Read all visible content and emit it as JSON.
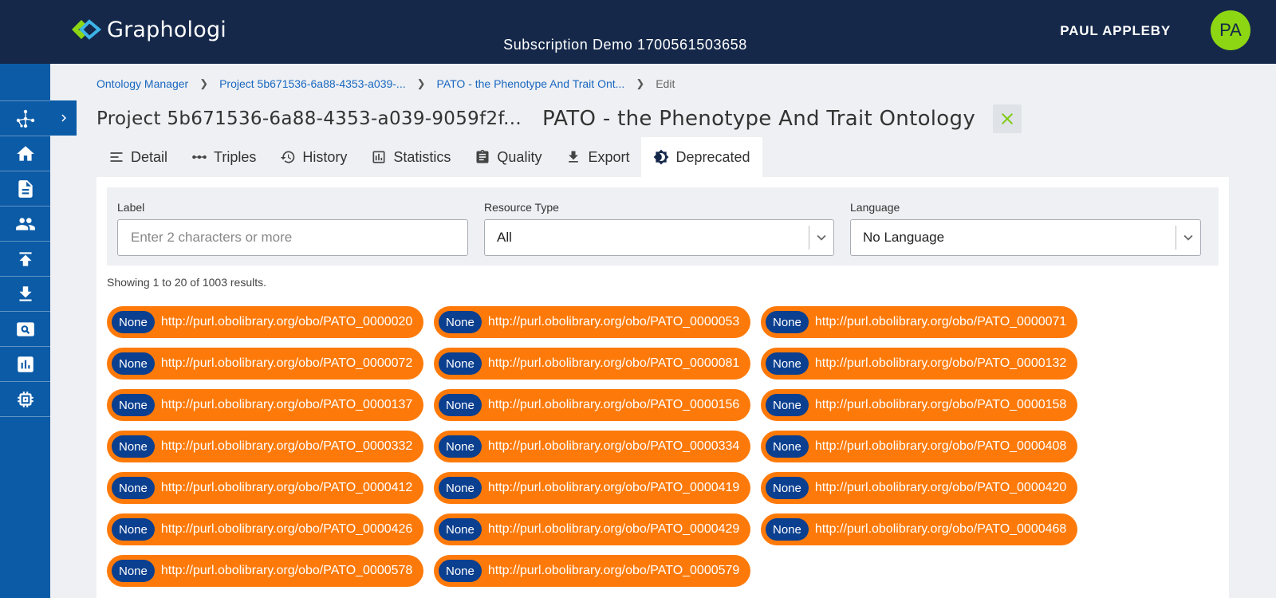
{
  "app": {
    "name": "Graphologi",
    "subscription": "Subscription Demo 1700561503658"
  },
  "user": {
    "name": "PAUL APPLEBY",
    "initials": "PA"
  },
  "sidebar": {
    "items": [
      {
        "icon": "graph-nodes-icon"
      },
      {
        "icon": "home-icon"
      },
      {
        "icon": "document-icon"
      },
      {
        "icon": "people-icon"
      },
      {
        "icon": "upload-icon"
      },
      {
        "icon": "download-icon"
      },
      {
        "icon": "search-screen-icon"
      },
      {
        "icon": "bar-chart-icon"
      },
      {
        "icon": "chip-icon"
      }
    ],
    "expand_icon": "chevron-right-icon"
  },
  "breadcrumb": {
    "items": [
      "Ontology Manager",
      "Project 5b671536-6a88-4353-a039-...",
      "PATO - the Phenotype And Trait Ont..."
    ],
    "current": "Edit"
  },
  "header": {
    "project_title": "Project 5b671536-6a88-4353-a039-9059f2f...",
    "ontology_title": "PATO - the Phenotype And Trait Ontology"
  },
  "tabs": [
    {
      "label": "Detail",
      "icon": "lines-icon"
    },
    {
      "label": "Triples",
      "icon": "dots-line-icon"
    },
    {
      "label": "History",
      "icon": "history-icon"
    },
    {
      "label": "Statistics",
      "icon": "statistics-icon"
    },
    {
      "label": "Quality",
      "icon": "clipboard-icon"
    },
    {
      "label": "Export",
      "icon": "download-icon"
    },
    {
      "label": "Deprecated",
      "icon": "brightness-icon",
      "active": true
    }
  ],
  "filters": {
    "label": {
      "title": "Label",
      "value": "",
      "placeholder": "Enter 2 characters or more"
    },
    "resource_type": {
      "title": "Resource Type",
      "value": "All"
    },
    "language": {
      "title": "Language",
      "value": "No Language"
    }
  },
  "results": {
    "summary": "Showing 1 to 20 of 1003 results.",
    "items": [
      {
        "badge": "None",
        "uri": "http://purl.obolibrary.org/obo/PATO_0000020"
      },
      {
        "badge": "None",
        "uri": "http://purl.obolibrary.org/obo/PATO_0000053"
      },
      {
        "badge": "None",
        "uri": "http://purl.obolibrary.org/obo/PATO_0000071"
      },
      {
        "badge": "None",
        "uri": "http://purl.obolibrary.org/obo/PATO_0000072"
      },
      {
        "badge": "None",
        "uri": "http://purl.obolibrary.org/obo/PATO_0000081"
      },
      {
        "badge": "None",
        "uri": "http://purl.obolibrary.org/obo/PATO_0000132"
      },
      {
        "badge": "None",
        "uri": "http://purl.obolibrary.org/obo/PATO_0000137"
      },
      {
        "badge": "None",
        "uri": "http://purl.obolibrary.org/obo/PATO_0000156"
      },
      {
        "badge": "None",
        "uri": "http://purl.obolibrary.org/obo/PATO_0000158"
      },
      {
        "badge": "None",
        "uri": "http://purl.obolibrary.org/obo/PATO_0000332"
      },
      {
        "badge": "None",
        "uri": "http://purl.obolibrary.org/obo/PATO_0000334"
      },
      {
        "badge": "None",
        "uri": "http://purl.obolibrary.org/obo/PATO_0000408"
      },
      {
        "badge": "None",
        "uri": "http://purl.obolibrary.org/obo/PATO_0000412"
      },
      {
        "badge": "None",
        "uri": "http://purl.obolibrary.org/obo/PATO_0000419"
      },
      {
        "badge": "None",
        "uri": "http://purl.obolibrary.org/obo/PATO_0000420"
      },
      {
        "badge": "None",
        "uri": "http://purl.obolibrary.org/obo/PATO_0000426"
      },
      {
        "badge": "None",
        "uri": "http://purl.obolibrary.org/obo/PATO_0000429"
      },
      {
        "badge": "None",
        "uri": "http://purl.obolibrary.org/obo/PATO_0000468"
      },
      {
        "badge": "None",
        "uri": "http://purl.obolibrary.org/obo/PATO_0000578"
      },
      {
        "badge": "None",
        "uri": "http://purl.obolibrary.org/obo/PATO_0000579"
      }
    ]
  },
  "colors": {
    "header_bg": "#15284a",
    "sidebar_bg": "#0b5ba7",
    "accent_green": "#8dd613",
    "chip_bg": "#fd7a0a",
    "badge_bg": "#0b3f8f",
    "link": "#1967c0"
  }
}
